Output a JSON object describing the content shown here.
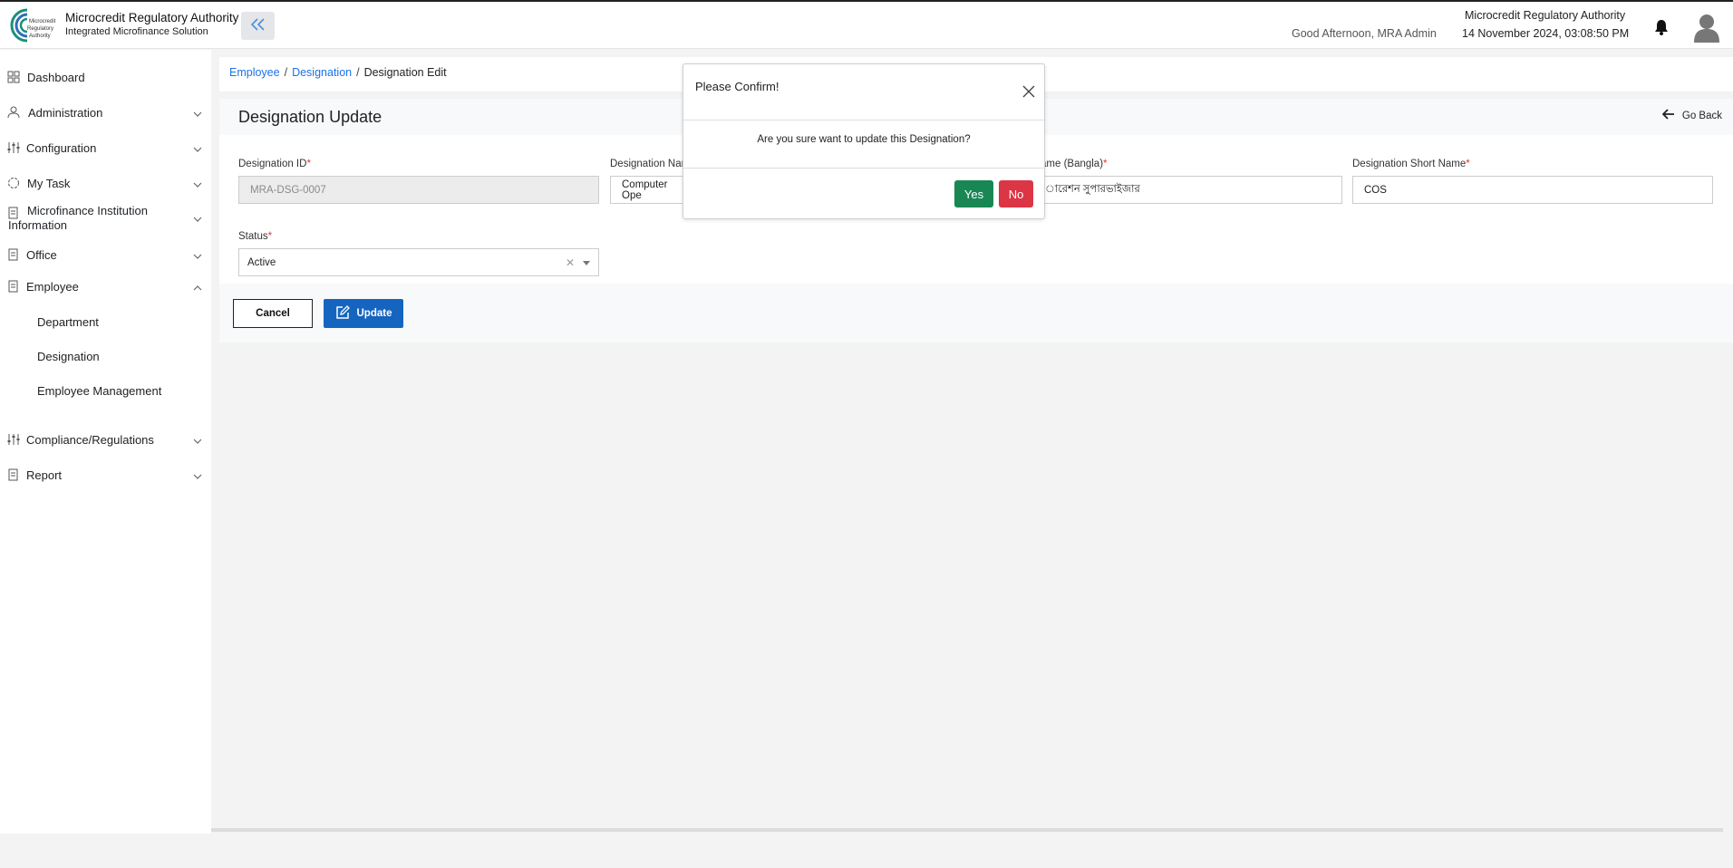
{
  "header": {
    "app_title": "Microcredit Regulatory Authority",
    "app_subtitle": "Integrated Microfinance Solution",
    "logo_text": [
      "Microcredit",
      "Regulatory",
      "Authority"
    ],
    "greeting": "Good Afternoon, MRA Admin",
    "org_name": "Microcredit Regulatory Authority",
    "datetime": "14 November 2024, 03:08:50 PM",
    "icons": {
      "collapse": "double-chevron-left-icon",
      "notification": "bell-icon",
      "avatar": "user-avatar-icon"
    }
  },
  "sidebar": {
    "items": [
      {
        "label": "Dashboard",
        "icon": "grid-icon"
      },
      {
        "label": "Administration",
        "icon": "user-settings-icon"
      },
      {
        "label": "Configuration",
        "icon": "sliders-icon"
      },
      {
        "label": "My Task",
        "icon": "task-circle-icon"
      },
      {
        "label": "Microfinance Institution",
        "label2": "Information",
        "icon": "document-icon"
      },
      {
        "label": "Office",
        "icon": "document-icon"
      },
      {
        "label": "Employee",
        "icon": "document-icon",
        "expanded": true
      },
      {
        "label": "Compliance/Regulations",
        "icon": "sliders-icon"
      },
      {
        "label": "Report",
        "icon": "document-icon"
      }
    ],
    "employee_sub": [
      "Department",
      "Designation",
      "Employee Management"
    ]
  },
  "breadcrumb": {
    "items": [
      "Employee",
      "Designation"
    ],
    "current": "Designation Edit"
  },
  "page": {
    "title": "Designation Update",
    "go_back": "Go Back"
  },
  "form": {
    "designation_id": {
      "label": "Designation ID",
      "value": "MRA-DSG-0007"
    },
    "designation_name": {
      "label": "Designation Nam",
      "value": "Computer Ope"
    },
    "designation_name_bangla": {
      "label": "ame (Bangla)",
      "value": "ারেশন সুপারভাইজার"
    },
    "designation_short_name": {
      "label": "Designation Short Name",
      "value": "COS"
    },
    "status": {
      "label": "Status",
      "value": "Active"
    },
    "required_mark": "*"
  },
  "actions": {
    "cancel": "Cancel",
    "update": "Update"
  },
  "modal": {
    "title": "Please Confirm!",
    "message": "Are you sure want to update this Designation?",
    "yes": "Yes",
    "no": "No"
  },
  "colors": {
    "link": "#1a73e8",
    "primary": "#1565c0",
    "success": "#198754",
    "danger": "#dc3545",
    "required": "#d93a3a"
  }
}
